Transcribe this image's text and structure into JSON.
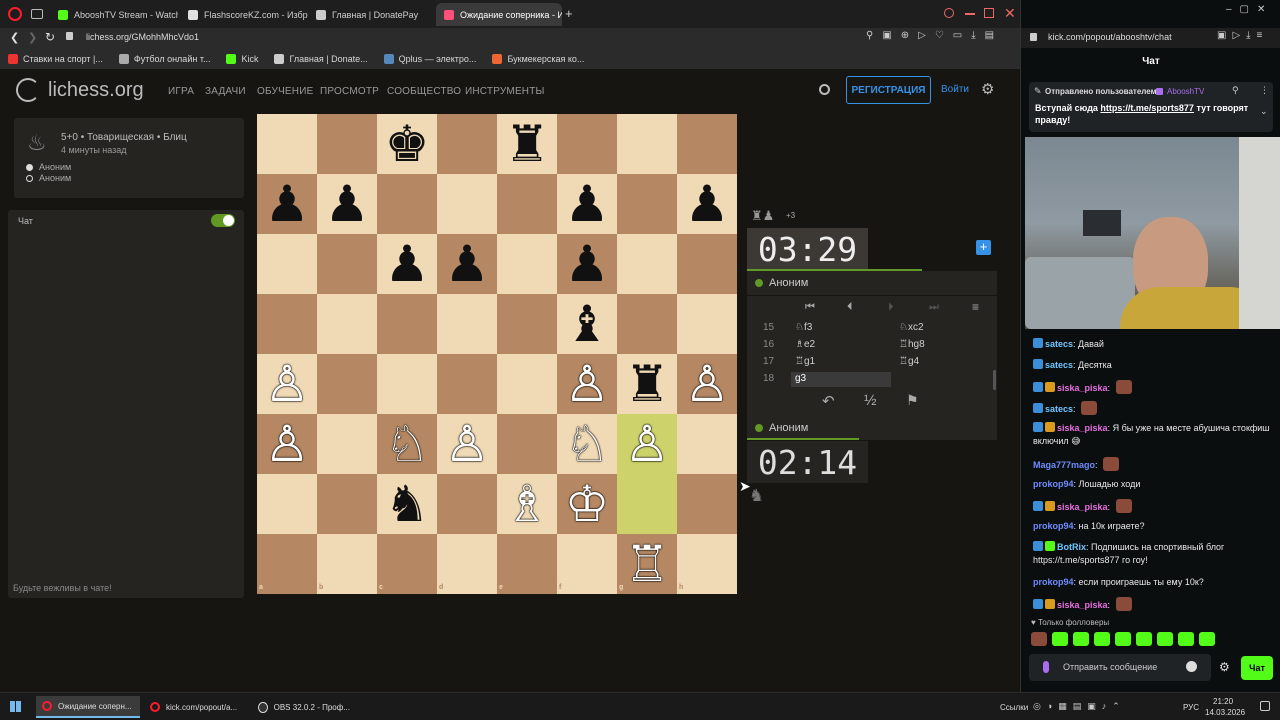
{
  "browser_left": {
    "tabs": [
      {
        "label": "AbooshTV Stream - Watch",
        "fav_color": "#53fc18"
      },
      {
        "label": "FlashscoreKZ.com - Избр",
        "fav_color": "#e0e0e0"
      },
      {
        "label": "Главная | DonatePay",
        "fav_color": "#cccccc"
      },
      {
        "label": "Ожидание соперника - И",
        "fav_color": "#ff4f7a",
        "active": true
      }
    ],
    "url": "lichess.org/GMohhMhcVdo1",
    "bookmarks": [
      {
        "label": "Ставки на спорт |...",
        "color": "#e33"
      },
      {
        "label": "Футбол онлайн т...",
        "color": "#aaa"
      },
      {
        "label": "Kick",
        "color": "#53fc18"
      },
      {
        "label": "Главная | Donate...",
        "color": "#ccc"
      },
      {
        "label": "Qplus — электро...",
        "color": "#58b"
      },
      {
        "label": "Букмекерская ко...",
        "color": "#e63"
      }
    ]
  },
  "lichess": {
    "logo": "lichess.org",
    "nav": [
      "ИГРА",
      "ЗАДАЧИ",
      "ОБУЧЕНИЕ",
      "ПРОСМОТР",
      "СООБЩЕСТВО",
      "ИНСТРУМЕНТЫ"
    ],
    "register_label": "РЕГИСТРАЦИЯ",
    "login_label": "Войти",
    "game_info": {
      "title": "5+0 • Товарищеская • Блиц",
      "time_ago": "4 минуты назад",
      "players": [
        "Аноним",
        "Аноним"
      ]
    },
    "chat": {
      "label": "Чат",
      "enabled": true,
      "placeholder": "Будьте вежливы в чате!"
    },
    "board": {
      "files": [
        "a",
        "b",
        "c",
        "d",
        "e",
        "f",
        "g",
        "h"
      ],
      "ranks": [
        "8",
        "7",
        "6",
        "5",
        "4",
        "3",
        "2",
        "1"
      ],
      "highlight": [
        "g3",
        "g2"
      ],
      "pieces": [
        {
          "sq": "c8",
          "p": "♚",
          "c": "b"
        },
        {
          "sq": "e8",
          "p": "♜",
          "c": "b"
        },
        {
          "sq": "a7",
          "p": "♟",
          "c": "b"
        },
        {
          "sq": "b7",
          "p": "♟",
          "c": "b"
        },
        {
          "sq": "f7",
          "p": "♟",
          "c": "b"
        },
        {
          "sq": "h7",
          "p": "♟",
          "c": "b"
        },
        {
          "sq": "c6",
          "p": "♟",
          "c": "b"
        },
        {
          "sq": "d6",
          "p": "♟",
          "c": "b"
        },
        {
          "sq": "f6",
          "p": "♟",
          "c": "b"
        },
        {
          "sq": "f5",
          "p": "♝",
          "c": "b"
        },
        {
          "sq": "a4",
          "p": "♙",
          "c": "w"
        },
        {
          "sq": "f4",
          "p": "♙",
          "c": "w"
        },
        {
          "sq": "g4",
          "p": "♜",
          "c": "b"
        },
        {
          "sq": "h4",
          "p": "♙",
          "c": "w"
        },
        {
          "sq": "a3",
          "p": "♙",
          "c": "w"
        },
        {
          "sq": "c3",
          "p": "♘",
          "c": "w"
        },
        {
          "sq": "d3",
          "p": "♙",
          "c": "w"
        },
        {
          "sq": "f3",
          "p": "♘",
          "c": "w"
        },
        {
          "sq": "g3",
          "p": "♙",
          "c": "w"
        },
        {
          "sq": "c2",
          "p": "♞",
          "c": "b"
        },
        {
          "sq": "e2",
          "p": "♗",
          "c": "w"
        },
        {
          "sq": "f2",
          "p": "♔",
          "c": "w"
        },
        {
          "sq": "g1",
          "p": "♖",
          "c": "w"
        }
      ]
    },
    "material_diff": "+3",
    "clock_top": "03:29",
    "clock_bottom": "02:14",
    "player_top": "Аноним",
    "player_bottom": "Аноним",
    "moves": [
      {
        "n": "15",
        "w": "♘f3",
        "b": "♘xc2"
      },
      {
        "n": "16",
        "w": "♗e2",
        "b": "♖hg8"
      },
      {
        "n": "17",
        "w": "♖g1",
        "b": "♖g4"
      },
      {
        "n": "18",
        "w": "g3",
        "b": ""
      }
    ],
    "draw_label": "½"
  },
  "browser_right": {
    "url": "kick.com/popout/abooshtv/chat",
    "header": "Чат",
    "pinned": {
      "by_label": "Отправлено пользователем",
      "by_user": "AbooshTV",
      "text_before": "Вступай сюда ",
      "link": "https://t.me/sports877",
      "text_after": " тут говорят правду!"
    },
    "messages": [
      {
        "user": "satecs",
        "color": "#6ec6ff",
        "badges": [
          "blue"
        ],
        "text": "Давай",
        "emote": false
      },
      {
        "user": "satecs",
        "color": "#6ec6ff",
        "badges": [
          "blue"
        ],
        "text": "Десятка",
        "emote": false
      },
      {
        "user": "siska_piska",
        "color": "#e86ee0",
        "badges": [
          "blue",
          "gold"
        ],
        "text": "",
        "emote": true
      },
      {
        "user": "satecs",
        "color": "#6ec6ff",
        "badges": [
          "blue"
        ],
        "text": "",
        "emote": true
      },
      {
        "user": "siska_piska",
        "color": "#e86ee0",
        "badges": [
          "blue",
          "gold"
        ],
        "text": "Я бы уже на месте абушича стокфиш включил 😅",
        "emote": false
      },
      {
        "user": "Maga777mago",
        "color": "#6e8cff",
        "badges": [],
        "text": "",
        "emote": true
      },
      {
        "user": "prokop94",
        "color": "#6e8cff",
        "badges": [],
        "text": "Лошадью ходи",
        "emote": false
      },
      {
        "user": "siska_piska",
        "color": "#e86ee0",
        "badges": [
          "blue",
          "gold"
        ],
        "text": "",
        "emote": true
      },
      {
        "user": "prokop94",
        "color": "#6e8cff",
        "badges": [],
        "text": "на 10к играете?",
        "emote": false
      },
      {
        "user": "BotRix",
        "color": "#6ec6ff",
        "badges": [
          "blue",
          "green"
        ],
        "text": "Подпишись на спортивный блог https://t.me/sports877 го гоу!",
        "emote": false
      },
      {
        "user": "prokop94",
        "color": "#6e8cff",
        "badges": [],
        "text": "если проиграешь ты ему 10к?",
        "emote": false
      },
      {
        "user": "siska_piska",
        "color": "#e86ee0",
        "badges": [
          "blue",
          "gold"
        ],
        "text": "",
        "emote": true
      }
    ],
    "followers_only": "Только фолловеры",
    "input_placeholder": "Отправить сообщение",
    "send_label": "Чат"
  },
  "taskbar": {
    "tasks": [
      {
        "label": "Ожидание соперн...",
        "active": true
      },
      {
        "label": "kick.com/popout/a...",
        "active": false
      },
      {
        "label": "OBS 32.0.2 - Проф...",
        "active": false
      }
    ],
    "links_label": "Ссылки",
    "lang": "РУС",
    "time": "21:20",
    "date": "14.03.2026"
  }
}
